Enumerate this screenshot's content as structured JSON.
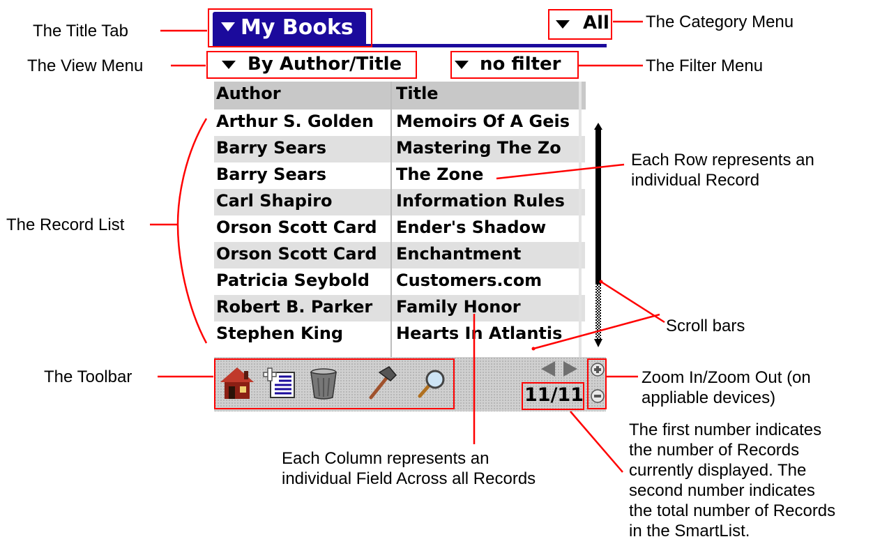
{
  "app": {
    "title": "My Books",
    "category": "All",
    "view": "By Author/Title",
    "filter": "no filter"
  },
  "table": {
    "columns": [
      "Author",
      "Title"
    ],
    "rows": [
      {
        "author": "Arthur S. Golden",
        "title": "Memoirs Of A Geis"
      },
      {
        "author": "Barry Sears",
        "title": "Mastering The Zo"
      },
      {
        "author": "Barry Sears",
        "title": "The Zone"
      },
      {
        "author": "Carl Shapiro",
        "title": "Information Rules"
      },
      {
        "author": "Orson Scott Card",
        "title": "Ender's Shadow"
      },
      {
        "author": "Orson Scott Card",
        "title": "Enchantment"
      },
      {
        "author": "Patricia Seybold",
        "title": "Customers.com"
      },
      {
        "author": "Robert B. Parker",
        "title": "Family Honor"
      },
      {
        "author": "Stephen King",
        "title": "Hearts In Atlantis"
      }
    ]
  },
  "toolbar": {
    "icons": [
      "home-icon",
      "new-record-icon",
      "trash-icon",
      "hammer-icon",
      "magnifier-icon"
    ],
    "record_count": "11/11"
  },
  "annotations": {
    "title_tab": "The Title Tab",
    "view_menu": "The View Menu",
    "record_list": "The Record List",
    "toolbar": "The Toolbar",
    "category_menu": "The Category Menu",
    "filter_menu": "The Filter Menu",
    "row_note": [
      "Each Row represents an",
      "individual Record"
    ],
    "scroll_bars": "Scroll bars",
    "zoom_note": [
      "Zoom In/Zoom Out (on",
      "appliable devices)"
    ],
    "count_note": [
      "The first number indicates",
      "the number of Records",
      "currently displayed.  The",
      "second number indicates",
      "the total number of Records",
      "in the SmartList."
    ],
    "column_note": [
      "Each Column represents an",
      "individual Field Across all Records"
    ]
  },
  "colors": {
    "title_bar": "#1b0a9c",
    "callout": "#ff0000",
    "row_stripe": "#e0e0e0",
    "header": "#c8c8c8"
  }
}
